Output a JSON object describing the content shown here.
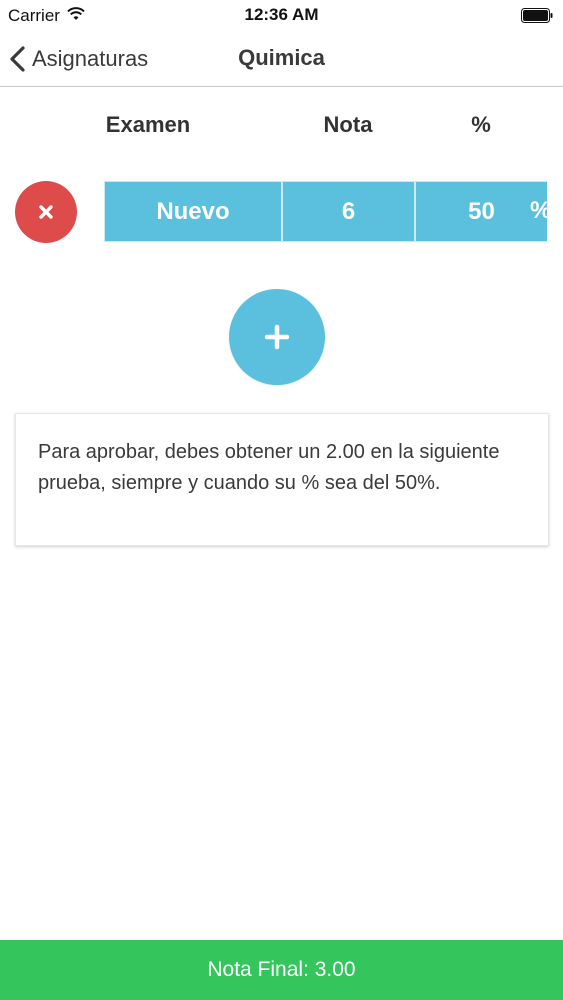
{
  "status_bar": {
    "carrier": "Carrier",
    "time": "12:36 AM"
  },
  "nav": {
    "back_label": "Asignaturas",
    "title": "Quimica"
  },
  "table": {
    "headers": [
      "Examen",
      "Nota",
      "%"
    ],
    "rows": [
      {
        "name": "Nuevo",
        "nota": "6",
        "percent": "50",
        "percent_suffix": "%"
      }
    ]
  },
  "info": {
    "message": "Para aprobar, debes obtener un 2.00 en la siguiente prueba, siempre y cuando su % sea del 50%."
  },
  "footer": {
    "label": "Nota Final: 3.00"
  },
  "colors": {
    "accent_blue": "#5bc0de",
    "delete_red": "#dd4b4b",
    "footer_green": "#34c65c"
  },
  "icons": {
    "back": "chevron-left-icon",
    "delete": "close-icon",
    "add": "plus-icon",
    "wifi": "wifi-icon",
    "battery": "battery-icon"
  }
}
